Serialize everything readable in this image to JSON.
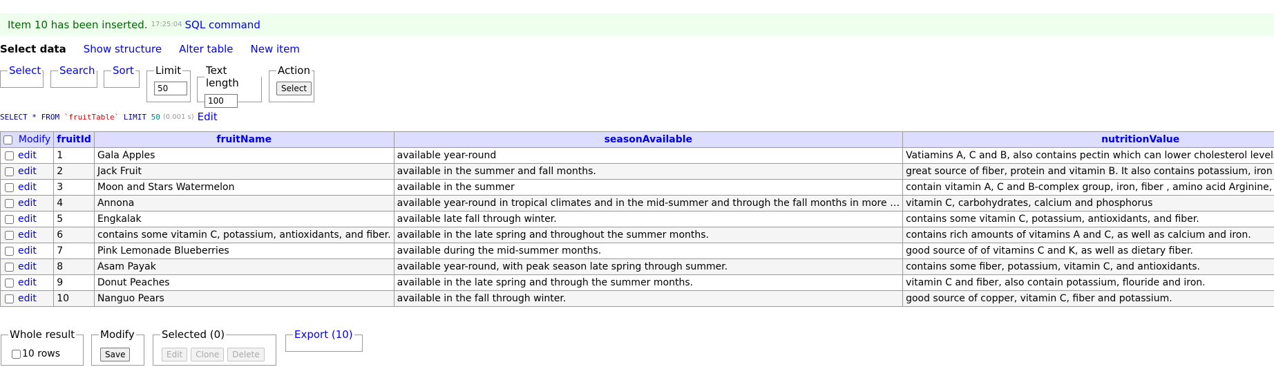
{
  "message": {
    "text": "Item 10 has been inserted.",
    "time": "17:25:04",
    "sql_command_link": "SQL command"
  },
  "nav": {
    "select_data": "Select data",
    "show_structure": "Show structure",
    "alter_table": "Alter table",
    "new_item": "New item"
  },
  "filters": {
    "select": "Select",
    "search": "Search",
    "sort": "Sort",
    "limit_legend": "Limit",
    "limit_value": "50",
    "text_length_legend": "Text length",
    "text_length_value": "100",
    "action_legend": "Action",
    "action_button": "Select"
  },
  "query": {
    "select": "SELECT * FROM",
    "table": "`fruitTable`",
    "limit_kw": "LIMIT",
    "limit_num": "50",
    "duration": "(0.001 s)",
    "edit_link": "Edit"
  },
  "table": {
    "modify_header": "Modify",
    "columns": [
      "fruitId",
      "fruitName",
      "seasonAvailable",
      "nutritionValue"
    ],
    "edit_label": "edit",
    "rows": [
      {
        "fruitId": "1",
        "fruitName": "Gala Apples",
        "seasonAvailable": "available year-round",
        "nutritionValue": "Vatiamins A, C and B, also contains pectin which can lower cholesterol levels  prevent heart a"
      },
      {
        "fruitId": "2",
        "fruitName": "Jack Fruit",
        "seasonAvailable": "available in the summer and fall months.",
        "nutritionValue": "great source of fiber, protein and vitamin B. It also contains potassium, iron and calcium."
      },
      {
        "fruitId": "3",
        "fruitName": "Moon and Stars Watermelon",
        "seasonAvailable": "available in the summer",
        "nutritionValue": "contain vitamin A, C and B-complex group, iron, fiber , amino acid Arginine, and potassium."
      },
      {
        "fruitId": "4",
        "fruitName": "Annona",
        "seasonAvailable": "available year-round in tropical climates and in the mid-summer and through the fall months in more …",
        "nutritionValue": "vitamin C, carbohydrates, calcium and phosphorus"
      },
      {
        "fruitId": "5",
        "fruitName": "Engkalak",
        "seasonAvailable": "available late fall through winter.",
        "nutritionValue": "contains some vitamin C, potassium, antioxidants, and fiber."
      },
      {
        "fruitId": "6",
        "fruitName": "contains some vitamin C, potassium, antioxidants, and fiber.",
        "seasonAvailable": "available in the late spring and throughout the summer months.",
        "nutritionValue": "contains rich amounts of vitamins A and C, as well as calcium and iron."
      },
      {
        "fruitId": "7",
        "fruitName": "Pink Lemonade Blueberries",
        "seasonAvailable": "available during the mid-summer months.",
        "nutritionValue": "good source of of vitamins C and K, as well as dietary fiber."
      },
      {
        "fruitId": "8",
        "fruitName": "Asam Payak",
        "seasonAvailable": "available year-round, with peak season late spring through summer.",
        "nutritionValue": "contains some fiber, potassium, vitamin C, and antioxidants."
      },
      {
        "fruitId": "9",
        "fruitName": "Donut Peaches",
        "seasonAvailable": "available in the late spring and through the summer months.",
        "nutritionValue": "vitamin C and fiber, also contain potassium, flouride and iron."
      },
      {
        "fruitId": "10",
        "fruitName": "Nanguo Pears",
        "seasonAvailable": "available in the fall through winter.",
        "nutritionValue": "good source of copper, vitamin C, fiber and potassium."
      }
    ]
  },
  "footer": {
    "whole_result_legend": "Whole result",
    "rows_label": "10 rows",
    "modify_legend": "Modify",
    "save_button": "Save",
    "selected_legend": "Selected (0)",
    "edit_button": "Edit",
    "clone_button": "Clone",
    "delete_button": "Delete",
    "export_legend": "Export (10)"
  }
}
